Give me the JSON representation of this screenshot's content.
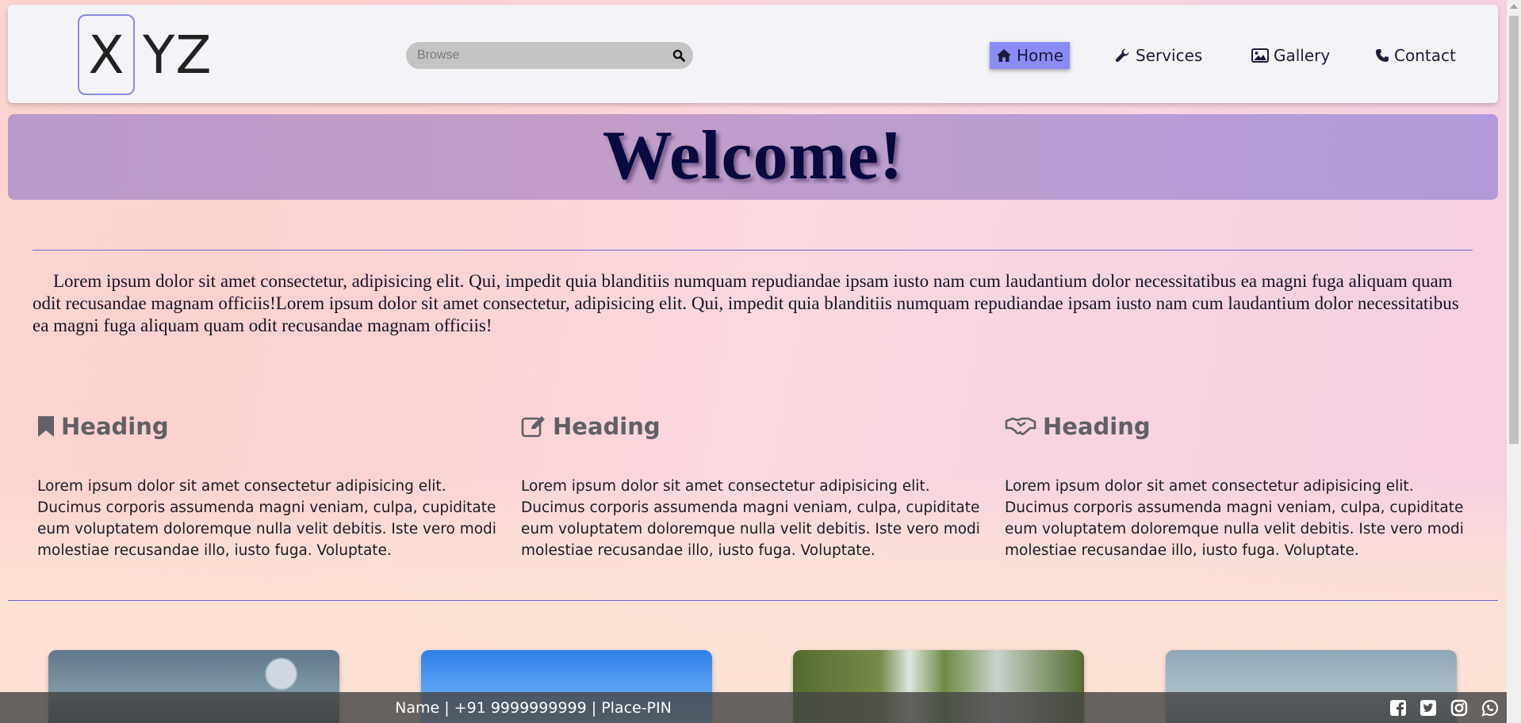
{
  "header": {
    "logo_first": "X",
    "logo_rest": "YZ",
    "search": {
      "placeholder": "Browse"
    },
    "nav": [
      {
        "label": "Home",
        "icon": "home-icon",
        "active": true
      },
      {
        "label": "Services",
        "icon": "wrench-icon",
        "active": false
      },
      {
        "label": "Gallery",
        "icon": "image-icon",
        "active": false
      },
      {
        "label": "Contact",
        "icon": "phone-icon",
        "active": false
      }
    ]
  },
  "banner": {
    "title": "Welcome!"
  },
  "intro": {
    "text": "Lorem ipsum dolor sit amet consectetur, adipisicing elit. Qui, impedit quia blanditiis numquam repudiandae ipsam iusto nam cum laudantium dolor necessitatibus ea magni fuga aliquam quam odit recusandae magnam officiis!Lorem ipsum dolor sit amet consectetur, adipisicing elit. Qui, impedit quia blanditiis numquam repudiandae ipsam iusto nam cum laudantium dolor necessitatibus ea magni fuga aliquam quam odit recusandae magnam officiis!"
  },
  "features": [
    {
      "icon": "bookmark-icon",
      "heading": "Heading",
      "text": "Lorem ipsum dolor sit amet consectetur adipisicing elit. Ducimus corporis assumenda magni veniam, culpa, cupiditate eum voluptatem doloremque nulla velit debitis. Iste vero modi molestiae recusandae illo, iusto fuga. Voluptate."
    },
    {
      "icon": "edit-icon",
      "heading": "Heading",
      "text": "Lorem ipsum dolor sit amet consectetur adipisicing elit. Ducimus corporis assumenda magni veniam, culpa, cupiditate eum voluptatem doloremque nulla velit debitis. Iste vero modi molestiae recusandae illo, iusto fuga. Voluptate."
    },
    {
      "icon": "handshake-icon",
      "heading": "Heading",
      "text": "Lorem ipsum dolor sit amet consectetur adipisicing elit. Ducimus corporis assumenda magni veniam, culpa, cupiditate eum voluptatem doloremque nulla velit debitis. Iste vero modi molestiae recusandae illo, iusto fuga. Voluptate."
    }
  ],
  "footer": {
    "text": "Name | +91 9999999999 | Place-PIN",
    "social": [
      "facebook-icon",
      "twitter-icon",
      "instagram-icon",
      "whatsapp-icon"
    ]
  },
  "colors": {
    "accent": "#8b8bf5",
    "title": "#07093f",
    "divider": "#6b6bd0"
  }
}
